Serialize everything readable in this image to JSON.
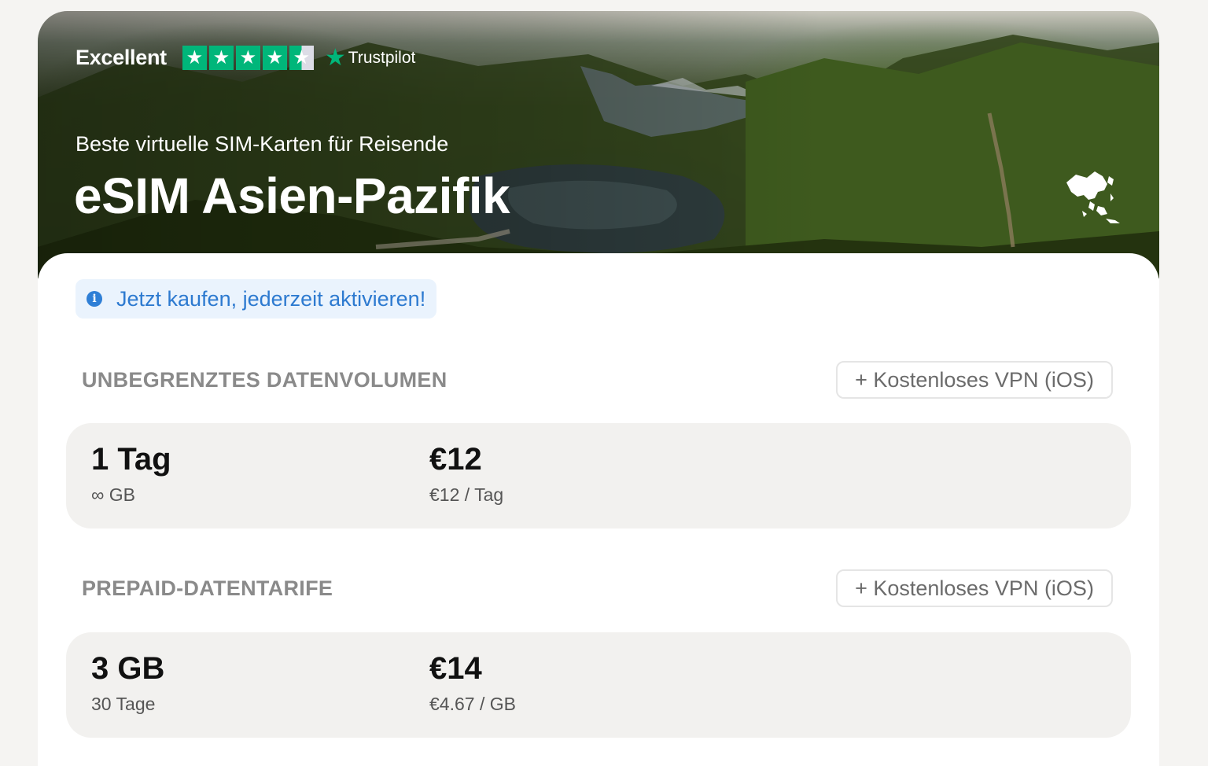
{
  "hero": {
    "trustpilot_rating_label": "Excellent",
    "trustpilot_star_count": 4.5,
    "trustpilot_brand": "Trustpilot",
    "subtitle": "Beste virtuelle SIM-Karten für Reisende",
    "title": "eSIM Asien-Pazifik"
  },
  "info_banner": {
    "text": "Jetzt kaufen, jederzeit aktivieren!",
    "icon": "info-icon"
  },
  "sections": [
    {
      "title": "UNBEGRENZTES DATENVOLUMEN",
      "vpn_button": "+ Kostenloses VPN (iOS)",
      "plans": [
        {
          "amount": "1 Tag",
          "sub": "∞ GB",
          "price": "€12",
          "per": "€12 / Tag"
        }
      ]
    },
    {
      "title": "PREPAID-DATENTARIFE",
      "vpn_button": "+ Kostenloses VPN (iOS)",
      "plans": [
        {
          "amount": "3 GB",
          "sub": "30 Tage",
          "price": "€14",
          "per": "€4.67 / GB"
        }
      ]
    }
  ],
  "colors": {
    "trustpilot_green": "#00b67a",
    "info_blue": "#2d7ad0",
    "info_bg": "#eaf3fd",
    "plan_bg": "#f2f1ef",
    "page_bg": "#f5f4f2"
  }
}
